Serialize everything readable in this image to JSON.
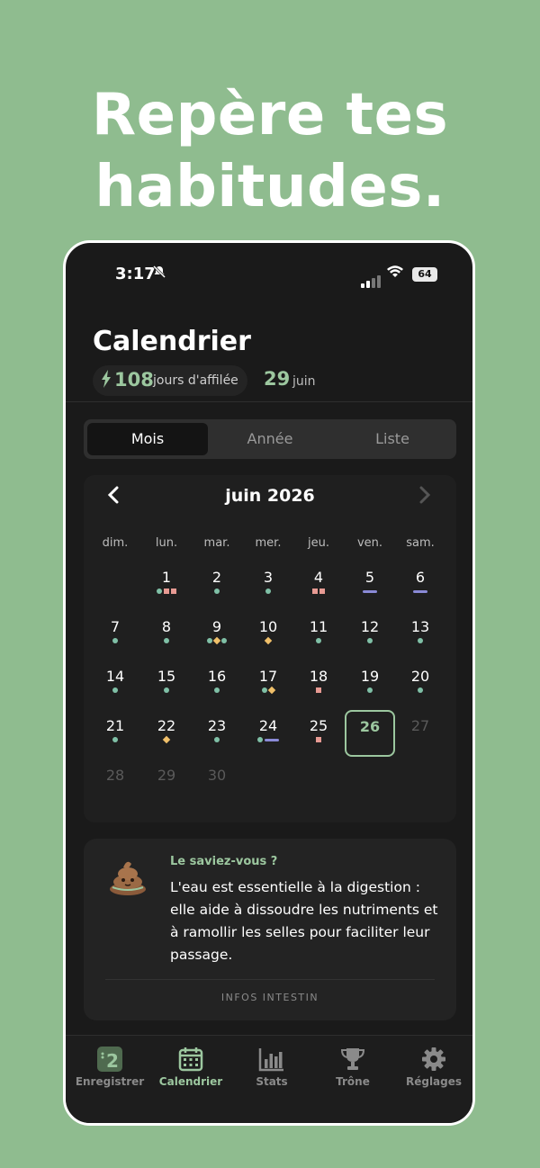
{
  "headline": [
    "Repère tes",
    "habitudes."
  ],
  "status": {
    "time": "3:17",
    "battery": "64"
  },
  "header": {
    "title": "Calendrier",
    "streak_value": "108",
    "streak_label": "jours d'affilée",
    "date_day": "29",
    "date_month": "juin"
  },
  "segments": [
    "Mois",
    "Année",
    "Liste"
  ],
  "calendar": {
    "month_label": "juin 2026",
    "weekdays": [
      "dim.",
      "lun.",
      "mar.",
      "mer.",
      "jeu.",
      "ven.",
      "sam."
    ],
    "today": "26",
    "days": [
      {
        "d": "1",
        "m": [
          "dot",
          "sq",
          "sq"
        ]
      },
      {
        "d": "2",
        "m": [
          "dot"
        ]
      },
      {
        "d": "3",
        "m": [
          "dot"
        ]
      },
      {
        "d": "4",
        "m": [
          "sq",
          "sq"
        ]
      },
      {
        "d": "5",
        "m": [
          "bar"
        ]
      },
      {
        "d": "6",
        "m": [
          "bar"
        ]
      },
      {
        "d": "7",
        "m": [
          "dot"
        ]
      },
      {
        "d": "8",
        "m": [
          "dot"
        ]
      },
      {
        "d": "9",
        "m": [
          "dot",
          "dia",
          "dot"
        ]
      },
      {
        "d": "10",
        "m": [
          "dia"
        ]
      },
      {
        "d": "11",
        "m": [
          "dot"
        ]
      },
      {
        "d": "12",
        "m": [
          "dot"
        ]
      },
      {
        "d": "13",
        "m": [
          "dot"
        ]
      },
      {
        "d": "14",
        "m": [
          "dot"
        ]
      },
      {
        "d": "15",
        "m": [
          "dot"
        ]
      },
      {
        "d": "16",
        "m": [
          "dot"
        ]
      },
      {
        "d": "17",
        "m": [
          "dot",
          "dia"
        ]
      },
      {
        "d": "18",
        "m": [
          "sq"
        ]
      },
      {
        "d": "19",
        "m": [
          "dot"
        ]
      },
      {
        "d": "20",
        "m": [
          "dot"
        ]
      },
      {
        "d": "21",
        "m": [
          "dot"
        ]
      },
      {
        "d": "22",
        "m": [
          "dia"
        ]
      },
      {
        "d": "23",
        "m": [
          "dot"
        ]
      },
      {
        "d": "24",
        "m": [
          "dot",
          "bar"
        ]
      },
      {
        "d": "25",
        "m": [
          "sq"
        ]
      },
      {
        "d": "26",
        "m": []
      },
      {
        "d": "27",
        "m": [],
        "future": true
      },
      {
        "d": "28",
        "m": [],
        "future": true
      },
      {
        "d": "29",
        "m": [],
        "future": true
      },
      {
        "d": "30",
        "m": [],
        "future": true
      }
    ],
    "first_weekday_index": 1
  },
  "tip": {
    "title": "Le saviez-vous ?",
    "body": "L'eau est essentielle à la digestion : elle aide à dissoudre les nutriments et à ramollir les selles pour faciliter leur passage.",
    "cta": "INFOS INTESTIN"
  },
  "tabs": [
    {
      "label": "Enregistrer",
      "icon": "log-icon",
      "badge": "2"
    },
    {
      "label": "Calendrier",
      "icon": "calendar-icon",
      "active": true
    },
    {
      "label": "Stats",
      "icon": "stats-icon"
    },
    {
      "label": "Trône",
      "icon": "trophy-icon"
    },
    {
      "label": "Réglages",
      "icon": "gear-icon"
    }
  ],
  "colors": {
    "background": "#8fbc8f",
    "accent": "#9cc79f",
    "dot": "#7fc0a6",
    "square": "#e79a93",
    "diamond": "#f0c06a",
    "bar": "#8a8ad6"
  }
}
